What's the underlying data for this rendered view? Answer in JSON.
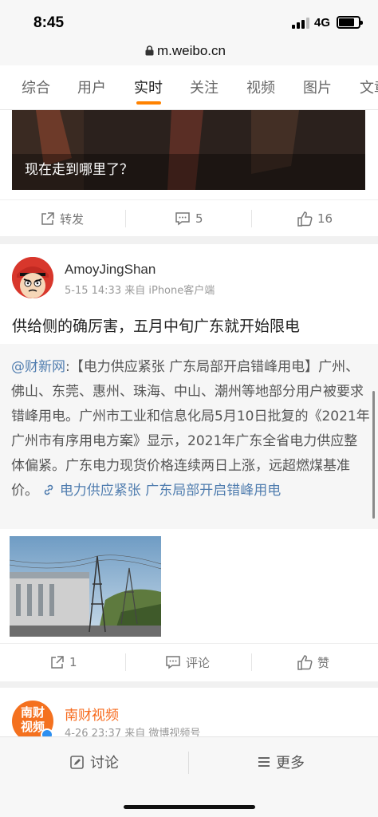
{
  "status": {
    "time": "8:45",
    "network": "4G"
  },
  "browser": {
    "url": "m.weibo.cn"
  },
  "tabs": [
    {
      "label": "综合"
    },
    {
      "label": "用户"
    },
    {
      "label": "实时"
    },
    {
      "label": "关注"
    },
    {
      "label": "视频"
    },
    {
      "label": "图片"
    },
    {
      "label": "文章"
    }
  ],
  "active_tab": "实时",
  "colors": {
    "accent": "#ff8200",
    "link": "#507daf",
    "orange_name": "#f76a1c"
  },
  "posts": [
    {
      "video_caption": "现在走到哪里了？",
      "actions": {
        "repost": "转发",
        "comments": "5",
        "likes": "16"
      }
    },
    {
      "author": "AmoyJingShan",
      "meta": "5-15 14:33 来自 iPhone客户端",
      "text": "供给侧的确厉害，五月中旬广东就开始限电",
      "repost": {
        "mention": "@财新网",
        "colon": ":",
        "body": "【电力供应紧张 广东局部开启错峰用电】广州、佛山、东莞、惠州、珠海、中山、潮州等地部分用户被要求错峰用电。广州市工业和信息化局5月10日批复的《2021年广州市有序用电方案》显示，2021年广东全省电力供应整体偏紧。广东电力现货价格连续两日上涨，远超燃煤基准价。",
        "link_text": "电力供应紧张 广东局部开启错峰用电"
      },
      "actions": {
        "repost": "1",
        "comments": "评论",
        "likes": "赞"
      }
    },
    {
      "author": "南财视频",
      "avatar_text": "南财视频",
      "meta": "4-26 23:37 来自 微博视频号"
    }
  ],
  "bottom_bar": {
    "discuss": "讨论",
    "more": "更多"
  }
}
